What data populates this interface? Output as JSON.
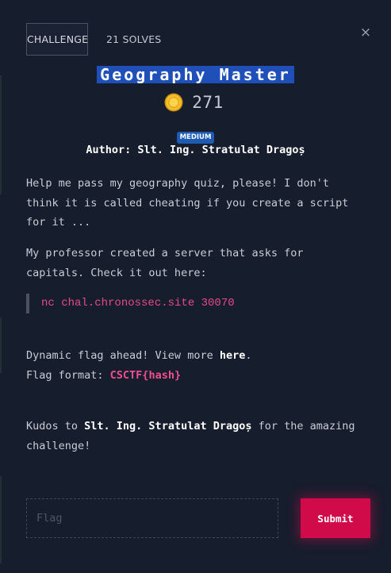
{
  "tabs": {
    "challenge_label": "CHALLENGE",
    "solves_label": "21 SOLVES"
  },
  "close_glyph": "×",
  "challenge": {
    "title": "Geography Master",
    "points": "271",
    "difficulty": "MEDIUM",
    "author_line": "Author: Slt. Ing. Stratulat Dragoș"
  },
  "description": {
    "p1": "Help me pass my geography quiz, please! I don't think it is called cheating if you create a script for it ...",
    "p2": "My professor created a server that asks for capitals. Check it out here:",
    "code": "nc chal.chronossec.site 30070",
    "dynamic_prefix": "Dynamic flag ahead! View more ",
    "dynamic_link": "here",
    "dynamic_suffix": ".",
    "format_prefix": "Flag format: ",
    "format_value": "CSCTF{hash}",
    "kudos_prefix": "Kudos to ",
    "kudos_name": "Slt. Ing. Stratulat Dragoș",
    "kudos_suffix": " for the amazing challenge!"
  },
  "form": {
    "flag_placeholder": "Flag",
    "flag_value": "",
    "submit_label": "Submit"
  },
  "colors": {
    "background": "#161d2d",
    "accent": "#d10b4a",
    "title_highlight": "#1f4fb9",
    "code_pink": "#e44a87",
    "difficulty_badge": "#1e5bb5"
  },
  "icons": {
    "close": "close-icon",
    "coin": "coin-icon"
  }
}
